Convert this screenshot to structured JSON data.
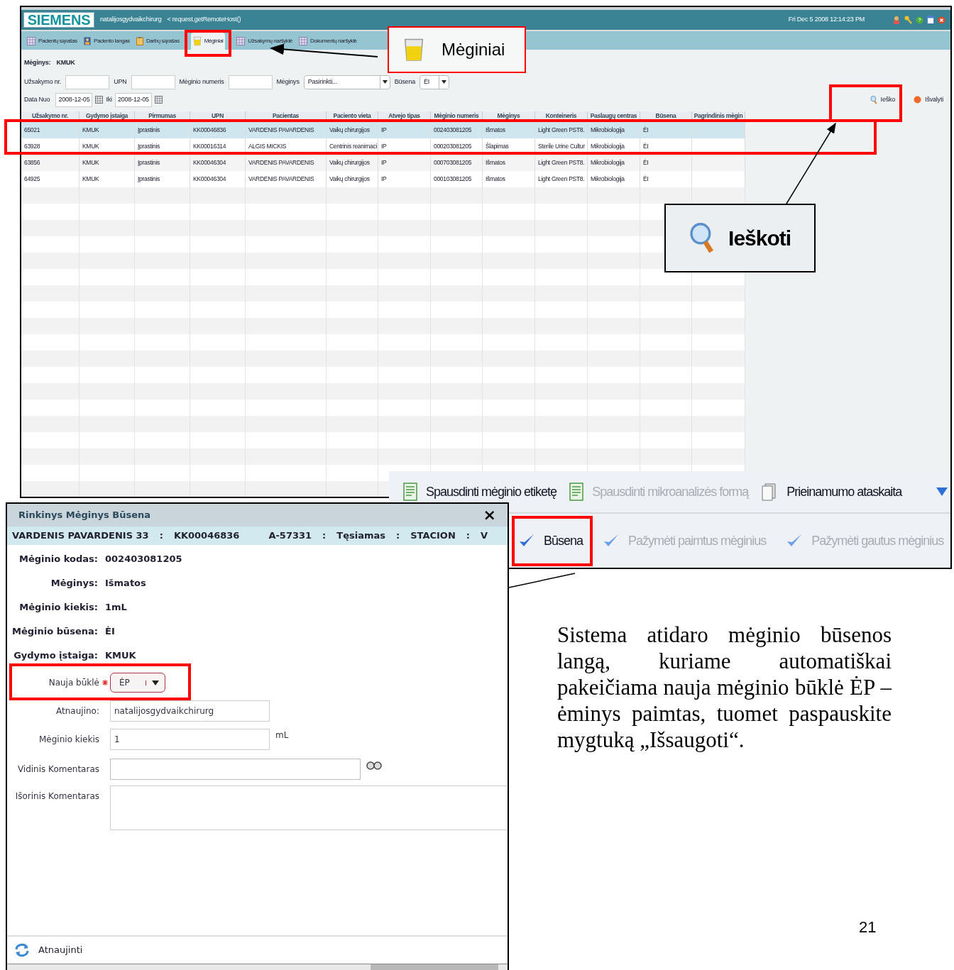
{
  "app": {
    "logo": "SIEMENS",
    "user": "natalijosgydvaikchirurg",
    "host": "< request.getRemoteHost()",
    "datetime": "Fri Dec 5 2008 12:14:23 PM",
    "tabs": [
      {
        "label": "Pacientų sąrašas",
        "selected": false
      },
      {
        "label": "Paciento langas",
        "selected": false
      },
      {
        "label": "Darbų sąrašas",
        "selected": false
      },
      {
        "label": "Mėginiai",
        "selected": true
      },
      {
        "label": "Užsakymų naršyklė",
        "selected": false
      },
      {
        "label": "Dokumentų naršyklė",
        "selected": false
      }
    ],
    "filter_title": {
      "label": "Mėginys:",
      "value": "KMUK"
    },
    "filters_row1": [
      {
        "kind": "input",
        "label": "Užsakymo nr."
      },
      {
        "kind": "input",
        "label": "UPN"
      },
      {
        "kind": "input",
        "label": "Mėginio numeris"
      },
      {
        "kind": "select",
        "label": "Mėginys",
        "value": "Pasirinkti..."
      },
      {
        "kind": "select",
        "label": "Būsena",
        "value": "ĖI"
      }
    ],
    "date_from": {
      "label": "Data Nuo",
      "value": "2008-12-05"
    },
    "date_to": {
      "label": "Iki",
      "value": "2008-12-05"
    },
    "actions": [
      "Ieško",
      "Išvalyti"
    ],
    "table": {
      "columns": [
        "Užsakymo nr.",
        "Gydymo įstaiga",
        "Pirmumas",
        "UPN",
        "Pacientas",
        "Paciento vieta",
        "Atvejo tipas",
        "Mėginio numeris",
        "Mėginys",
        "Konteineris",
        "Paslaugų centras",
        "Būsena",
        "Pagrindinis mėgin"
      ],
      "rows": [
        {
          "selected": true,
          "cells": [
            "65021",
            "KMUK",
            "Įprastinis",
            "KK00046836",
            "VARDENIS PAVARDENIS",
            "Vaikų chirurgijos",
            "IP",
            "002403081205",
            "Išmatos",
            "Light Green PST8.",
            "Mikrobiologija",
            "ĖI",
            ""
          ]
        },
        {
          "selected": false,
          "cells": [
            "63928",
            "KMUK",
            "Įprastinis",
            "KK00016314",
            "ALGIS MICKIS",
            "Centrinis reanimaci",
            "IP",
            "000203081205",
            "Šlapimas",
            "Sterile Urine Cultur",
            "Mikrobiologija",
            "ĖI",
            ""
          ]
        },
        {
          "selected": false,
          "cells": [
            "63856",
            "KMUK",
            "Įprastinis",
            "KK00046304",
            "VARDENIS PAVARDENIS",
            "Vaikų chirurgijos",
            "IP",
            "000703081205",
            "Išmatos",
            "Light Green PST8.",
            "Mikrobiologija",
            "ĖI",
            ""
          ]
        },
        {
          "selected": false,
          "cells": [
            "64925",
            "KMUK",
            "Įprastinis",
            "KK00046304",
            "VARDENIS PAVARDENIS",
            "Vaikų chirurgijos",
            "IP",
            "000103081205",
            "Išmatos",
            "Light Green PST8.",
            "Mikrobiologija",
            "ĖI",
            ""
          ]
        }
      ]
    }
  },
  "tab_callout": {
    "label": "Mėginiai"
  },
  "search_callout": {
    "label": "Ieškoti"
  },
  "toolbar": {
    "row1": [
      {
        "label": "Spausdinti mėginio etiketę",
        "disabled": false
      },
      {
        "label": "Spausdinti mikroanalizės formą",
        "disabled": true
      },
      {
        "label": "Prieinamumo ataskaita",
        "disabled": false
      }
    ],
    "row2": [
      {
        "label": "Būsena",
        "disabled": false
      },
      {
        "label": "Pažymėti paimtus mėginius",
        "disabled": true
      },
      {
        "label": "Pažymėti gautus mėginius",
        "disabled": true
      }
    ]
  },
  "dialog": {
    "title": "Rinkinys Mėginys Būsena",
    "close": "×",
    "info": [
      "VARDENIS PAVARDENIS 33",
      ":",
      "KK00046836",
      "A-57331",
      ":",
      "Tęsiamas",
      ":",
      "STACION",
      ":",
      "V"
    ],
    "details": [
      {
        "label": "Mėginio kodas:",
        "value": "002403081205"
      },
      {
        "label": "Mėginys:",
        "value": "Išmatos"
      },
      {
        "label": "Mėginio kiekis:",
        "value": "1mL"
      },
      {
        "label": "Mėginio būsena:",
        "value": "ĖI"
      },
      {
        "label": "Gydymo įstaiga:",
        "value": "KMUK"
      }
    ],
    "new_state": {
      "label": "Nauja būklė",
      "required": true,
      "value": "ĖP"
    },
    "updated_by": {
      "label": "Atnaujino:",
      "value": "natalijosgydvaikchirurg"
    },
    "amount": {
      "label": "Mėginio kiekis",
      "value": "1",
      "unit": "mL"
    },
    "internal_comment": {
      "label": "Vidinis Komentaras"
    },
    "external_comment": {
      "label": "Išorinis Komentaras"
    },
    "footer_button": "Atnaujinti"
  },
  "paragraph": "Sistema atidaro mėginio būsenos langą, kuriame automatiškai pakeičiama nauja mėginio būklė ĖP – ėminys paimtas, tuomet paspauskite mygtuką „Išsaugoti“.",
  "page_number": "21"
}
